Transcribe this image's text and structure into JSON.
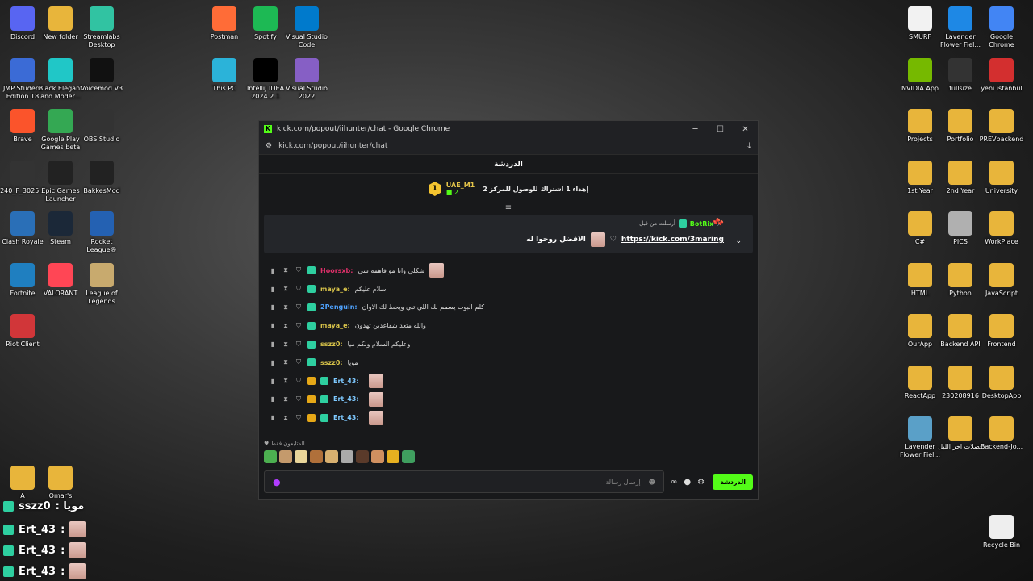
{
  "desktop": {
    "left_col1": [
      "Discord",
      "JMP Student Edition 18",
      "Brave",
      "240_F_3025...",
      "Clash Royale",
      "Fortnite",
      "Riot Client",
      "A"
    ],
    "left_col2": [
      "New folder",
      "Black Elegant and Moder...",
      "Google Play Games beta",
      "Epic Games Launcher",
      "Steam",
      "VALORANT",
      "Omar's"
    ],
    "left_col3": [
      "Streamlabs Desktop",
      "Voicemod V3",
      "OBS Studio",
      "BakkesMod",
      "Rocket League®",
      "League of Legends"
    ],
    "mid_col1": [
      "Postman",
      "This PC"
    ],
    "mid_col2": [
      "Spotify",
      "IntelliJ IDEA 2024.2.1"
    ],
    "mid_col3": [
      "Visual Studio Code",
      "Visual Studio 2022"
    ],
    "right_col1": [
      "SMURF",
      "NVIDIA App",
      "Projects",
      "1st Year",
      "C#",
      "HTML",
      "OurApp",
      "ReactApp",
      "Lavender Flower Fiel..."
    ],
    "right_col2": [
      "Lavender Flower Fiel...",
      "fullsize",
      "Portfolio",
      "2nd Year",
      "PICS",
      "Python",
      "Backend API",
      "230208916",
      "فصلات اخر الليل"
    ],
    "right_col3": [
      "Google Chrome",
      "yeni istanbul",
      "PREVbackend",
      "University",
      "WorkPlace",
      "JavaScript",
      "Frontend",
      "DesktopApp",
      "Backend-Jo...",
      "Recycle Bin"
    ]
  },
  "window": {
    "title": "kick.com/popout/iihunter/chat - Google Chrome",
    "url": "kick.com/popout/iihunter/chat",
    "minimize": "─",
    "maximize": "☐",
    "close": "✕"
  },
  "chat": {
    "header": "الدردشة",
    "leaderboard": {
      "rank": "1",
      "name": "UAE_M1",
      "count": "2",
      "goal": "إهداء 1 اشتراك للوصول للمركز 2"
    },
    "pinned": {
      "pinned_by": "أرسلت من قبل",
      "user": "BotRix",
      "link": "https://kick.com/3maring",
      "text": "الافضل روحوا له"
    },
    "messages": [
      {
        "user": "Hoorsxb",
        "color": "#e0306a",
        "text": "شكلي وانا مو فاهمه شي"
      },
      {
        "user": "maya_e",
        "color": "#d9c44a",
        "text": "سلام عليكم"
      },
      {
        "user": "2Penguin",
        "color": "#4fa3ff",
        "text": "كلم البوت يسمم لك اللي تبي ويحط لك الاوان"
      },
      {
        "user": "maya_e",
        "color": "#d9c44a",
        "text": "والله متعد شفاعدين تهدون"
      },
      {
        "user": "sszz0",
        "color": "#d9c44a",
        "text": "وعليكم السلام ولكم ميا"
      },
      {
        "user": "sszz0",
        "color": "#d9c44a",
        "text": "مويا"
      },
      {
        "user": "Ert_43",
        "color": "#7ec9ff",
        "text": ""
      },
      {
        "user": "Ert_43",
        "color": "#7ec9ff",
        "text": ""
      },
      {
        "user": "Ert_43",
        "color": "#7ec9ff",
        "text": ""
      }
    ],
    "emote_header": "المتابعون فقط",
    "input_placeholder": "إرسال رسالة",
    "send_label": "الدردشة"
  },
  "overlay": [
    {
      "user": "sszz0",
      "text": ": مويا"
    },
    {
      "user": "Ert_43",
      "text": ":"
    },
    {
      "user": "Ert_43",
      "text": ":"
    },
    {
      "user": "Ert_43",
      "text": ":"
    }
  ],
  "colors": {
    "kick_green": "#53fc18",
    "folder": "#e8b53b"
  }
}
